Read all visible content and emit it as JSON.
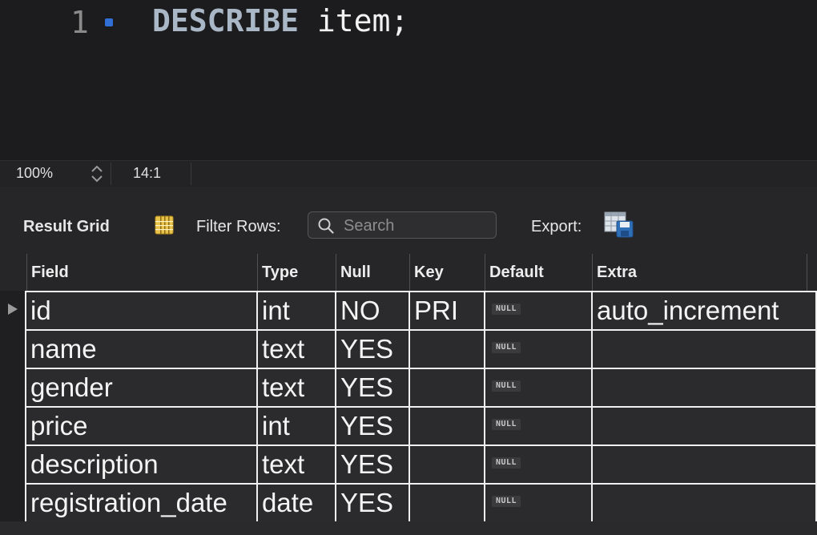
{
  "editor": {
    "line_number": "1",
    "code_keyword": "DESCRIBE",
    "code_rest": " item;"
  },
  "statusbar": {
    "zoom": "100%",
    "cursor_position": "14:1"
  },
  "toolbar": {
    "result_grid_label": "Result Grid",
    "filter_label": "Filter Rows:",
    "search_placeholder": "Search",
    "search_value": "",
    "export_label": "Export:",
    "icons": [
      "grid-layout-icon",
      "search-icon",
      "export-spreadsheet-icon"
    ]
  },
  "grid": {
    "columns": [
      "Field",
      "Type",
      "Null",
      "Key",
      "Default",
      "Extra"
    ],
    "rows": [
      {
        "field": "id",
        "type": "int",
        "null": "NO",
        "key": "PRI",
        "default": "NULL",
        "extra": "auto_increment",
        "selected": true
      },
      {
        "field": "name",
        "type": "text",
        "null": "YES",
        "key": "",
        "default": "NULL",
        "extra": ""
      },
      {
        "field": "gender",
        "type": "text",
        "null": "YES",
        "key": "",
        "default": "NULL",
        "extra": ""
      },
      {
        "field": "price",
        "type": "int",
        "null": "YES",
        "key": "",
        "default": "NULL",
        "extra": ""
      },
      {
        "field": "description",
        "type": "text",
        "null": "YES",
        "key": "",
        "default": "NULL",
        "extra": ""
      },
      {
        "field": "registration_date",
        "type": "date",
        "null": "YES",
        "key": "",
        "default": "NULL",
        "extra": ""
      }
    ]
  },
  "colors": {
    "background": "#1e1e1e",
    "line_marker": "#2f6fd6",
    "keyword": "#a9b7c6",
    "grid_lines": "#f0f0f0"
  }
}
